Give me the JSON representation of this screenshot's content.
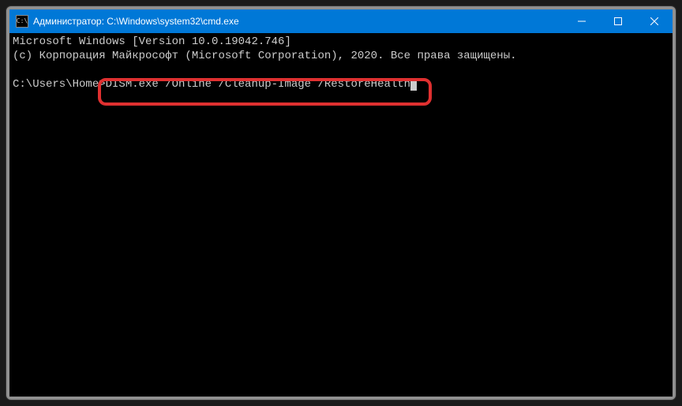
{
  "window": {
    "icon_glyph": "C:\\",
    "title": "Администратор: C:\\Windows\\system32\\cmd.exe"
  },
  "terminal": {
    "line1": "Microsoft Windows [Version 10.0.19042.746]",
    "line2": "(c) Корпорация Майкрософт (Microsoft Corporation), 2020. Все права защищены.",
    "blank": "",
    "prompt": "C:\\Users\\Home>",
    "command": "DISM.exe /Online /Cleanup-Image /RestoreHealth"
  }
}
